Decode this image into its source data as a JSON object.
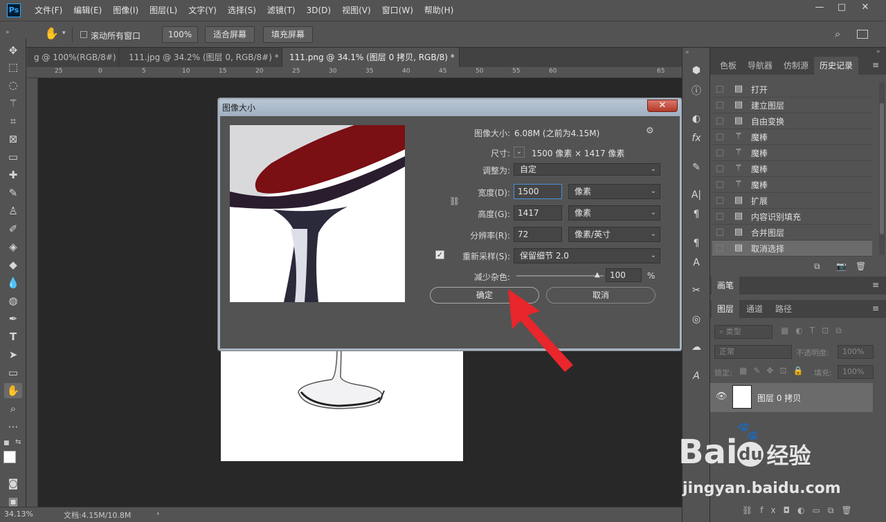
{
  "app": {
    "logo": "Ps",
    "menus": [
      "文件(F)",
      "编辑(E)",
      "图像(I)",
      "图层(L)",
      "文字(Y)",
      "选择(S)",
      "滤镜(T)",
      "3D(D)",
      "视图(V)",
      "窗口(W)",
      "帮助(H)"
    ],
    "window_buttons": [
      "—",
      "□",
      "✕"
    ]
  },
  "options": {
    "scroll_all_label": "滚动所有窗口",
    "zoom_btn": "100%",
    "fit_screen": "适合屏幕",
    "fill_screen": "填充屏幕"
  },
  "tabs": [
    {
      "label": "g @ 100%(RGB/8#) *",
      "close": "✕"
    },
    {
      "label": "111.jpg @ 34.2% (图层 0, RGB/8#) *",
      "close": "✕"
    },
    {
      "label": "111.png @ 34.1% (图层 0 拷贝, RGB/8) *",
      "close": "✕"
    }
  ],
  "ruler_labels": [
    "25",
    "0",
    "5",
    "10",
    "15",
    "20",
    "25",
    "30",
    "35",
    "40",
    "45",
    "50",
    "55",
    "60",
    "65"
  ],
  "status": {
    "zoom": "34.13%",
    "doc": "文档:4.15M/10.8M",
    "arrow": "›"
  },
  "dialog": {
    "title": "图像大小",
    "close": "✕",
    "image_size_label": "图像大小:",
    "image_size_value": "6.08M (之前为4.15M)",
    "dimensions_label": "尺寸:",
    "dimensions_value": "1500 像素  ×  1417 像素",
    "fit_to_label": "调整为:",
    "fit_to_value": "自定",
    "width_label": "宽度(D):",
    "width_value": "1500",
    "width_unit": "像素",
    "height_label": "高度(G):",
    "height_value": "1417",
    "height_unit": "像素",
    "resolution_label": "分辨率(R):",
    "resolution_value": "72",
    "resolution_unit": "像素/英寸",
    "resample_label": "重新采样(S):",
    "resample_checked": true,
    "resample_value": "保留细节 2.0",
    "noise_label": "减少杂色:",
    "noise_value": "100",
    "noise_unit": "%",
    "ok_label": "确定",
    "cancel_label": "取消"
  },
  "panels": {
    "top_tabs": [
      "色板",
      "导航器",
      "仿制源",
      "历史记录"
    ],
    "history": [
      {
        "icon": "document-icon",
        "label": "打开"
      },
      {
        "icon": "document-icon",
        "label": "建立图层"
      },
      {
        "icon": "document-icon",
        "label": "自由变换"
      },
      {
        "icon": "magic-wand-icon",
        "label": "魔棒"
      },
      {
        "icon": "magic-wand-icon",
        "label": "魔棒"
      },
      {
        "icon": "magic-wand-icon",
        "label": "魔棒"
      },
      {
        "icon": "magic-wand-icon",
        "label": "魔棒"
      },
      {
        "icon": "document-icon",
        "label": "扩展"
      },
      {
        "icon": "document-icon",
        "label": "内容识别填充"
      },
      {
        "icon": "document-icon",
        "label": "合并图层"
      },
      {
        "icon": "document-icon",
        "label": "取消选择"
      }
    ],
    "brush_tab": "画笔",
    "layer_tabs": [
      "图层",
      "通道",
      "路径"
    ],
    "filter_kind": "类型",
    "blend_mode": "正常",
    "opacity_label": "不透明度:",
    "opacity_value": "100%",
    "lock_label": "锁定:",
    "fill_label": "填充:",
    "fill_value": "100%",
    "layer_name": "图层 0 拷贝",
    "watermark_brand": "Bai",
    "watermark_du": "du",
    "watermark_jingyan": "经验",
    "watermark_url": "jingyan.baidu.com"
  },
  "colors": {
    "accent_arrow": "#e8262b",
    "ps_blue": "#31a8ff"
  }
}
